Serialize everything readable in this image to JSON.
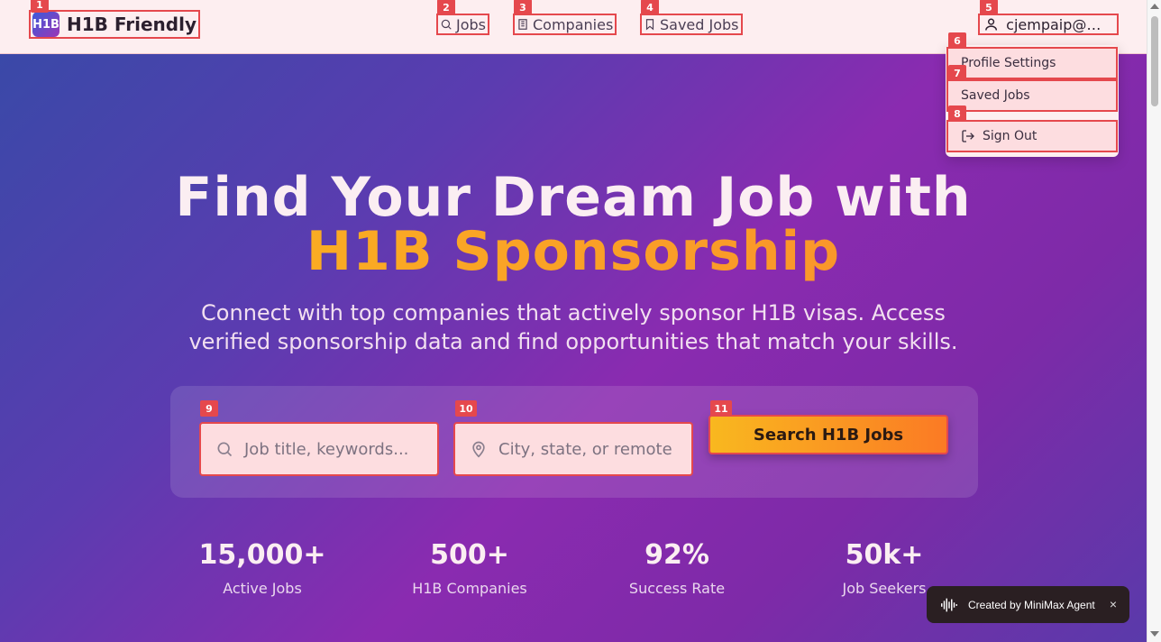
{
  "brand": {
    "logo_text": "H1B",
    "name": "H1B Friendly"
  },
  "nav": {
    "jobs": "Jobs",
    "companies": "Companies",
    "saved_jobs": "Saved Jobs"
  },
  "user": {
    "email": "cjempaip@mi..."
  },
  "dropdown": {
    "profile_settings": "Profile Settings",
    "saved_jobs": "Saved Jobs",
    "sign_out": "Sign Out"
  },
  "hero": {
    "title_line1": "Find Your Dream Job with",
    "title_line2": "H1B Sponsorship",
    "subtitle_line1": "Connect with top companies that actively sponsor H1B visas. Access",
    "subtitle_line2": "verified sponsorship data and find opportunities that match your skills."
  },
  "search": {
    "keywords_placeholder": "Job title, keywords...",
    "location_placeholder": "City, state, or remote",
    "button": "Search H1B Jobs"
  },
  "stats": [
    {
      "value": "15,000+",
      "label": "Active Jobs"
    },
    {
      "value": "500+",
      "label": "H1B Companies"
    },
    {
      "value": "92%",
      "label": "Success Rate"
    },
    {
      "value": "50k+",
      "label": "Job Seekers"
    }
  ],
  "toast": {
    "text": "Created by MiniMax Agent",
    "close": "×"
  },
  "badges": [
    "1",
    "2",
    "3",
    "4",
    "5",
    "6",
    "7",
    "8",
    "9",
    "10",
    "11"
  ],
  "colors": {
    "accent": "#e5484d",
    "cta_start": "#f9b81f",
    "cta_end": "#fb7a24",
    "hero_purple": "#8a2bb0"
  },
  "icons": [
    "search-icon",
    "building-icon",
    "bookmark-icon",
    "user-icon",
    "sign-out-icon",
    "map-pin-icon",
    "waveform-icon",
    "close-icon"
  ]
}
